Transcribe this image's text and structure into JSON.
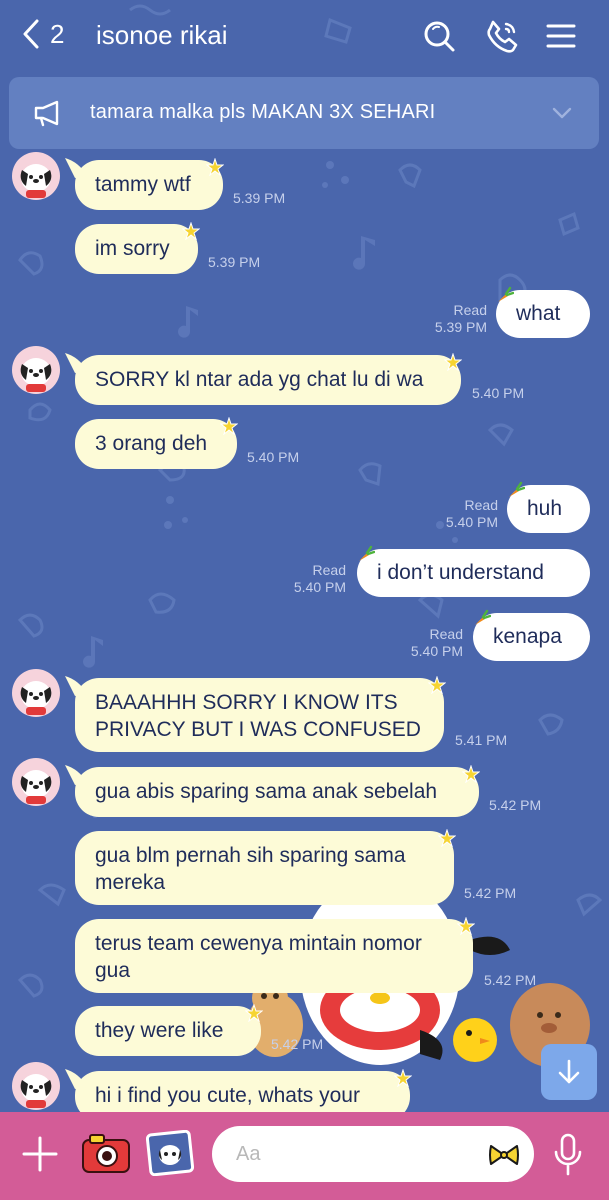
{
  "header": {
    "back_count": "2",
    "title": "isonoe rikai",
    "icons": [
      "chevron-left-icon",
      "search-icon",
      "phone-icon",
      "menu-icon"
    ]
  },
  "announcement": {
    "text": "tamara malka pls MAKAN 3X SEHARI",
    "icon": "megaphone-icon"
  },
  "messages": [
    {
      "direction": "in",
      "text": "tammy wtf",
      "time": "5.39 PM"
    },
    {
      "direction": "in",
      "text": "im sorry",
      "time": "5.39 PM"
    },
    {
      "direction": "out",
      "text": "what",
      "status": "Read",
      "time": "5.39 PM"
    },
    {
      "direction": "in",
      "text": "SORRY kl ntar ada yg chat lu di wa",
      "time": "5.40 PM"
    },
    {
      "direction": "in",
      "text": "3 orang deh",
      "time": "5.40 PM"
    },
    {
      "direction": "out",
      "text": "huh",
      "status": "Read",
      "time": "5.40 PM"
    },
    {
      "direction": "out",
      "text": "i don’t understand",
      "status": "Read",
      "time": "5.40 PM"
    },
    {
      "direction": "out",
      "text": "kenapa",
      "status": "Read",
      "time": "5.40 PM"
    },
    {
      "direction": "in",
      "text": "BAAAHHH SORRY I KNOW ITS PRIVACY BUT I WAS CONFUSED",
      "time": "5.41 PM"
    },
    {
      "direction": "in",
      "text": "gua abis sparing sama anak sebelah",
      "time": "5.42 PM"
    },
    {
      "direction": "in",
      "text": "gua blm pernah sih sparing sama mereka",
      "time": "5.42 PM"
    },
    {
      "direction": "in",
      "text": "terus team cewenya mintain nomor gua",
      "time": "5.42 PM"
    },
    {
      "direction": "in",
      "text": "they were like",
      "time": "5.42 PM"
    },
    {
      "direction": "in",
      "text": "hi i find you cute, whats your",
      "time": ""
    }
  ],
  "composer": {
    "placeholder": "Aa",
    "icons": [
      "plus-icon",
      "camera-icon",
      "photo-icon",
      "bow-icon",
      "microphone-icon"
    ]
  },
  "colors": {
    "background": "#4a66ac",
    "incoming_bubble": "#fdfbd7",
    "outgoing_bubble": "#ffffff",
    "bottom_bar": "#d35c97",
    "announcement_bar": "#6380c1"
  }
}
